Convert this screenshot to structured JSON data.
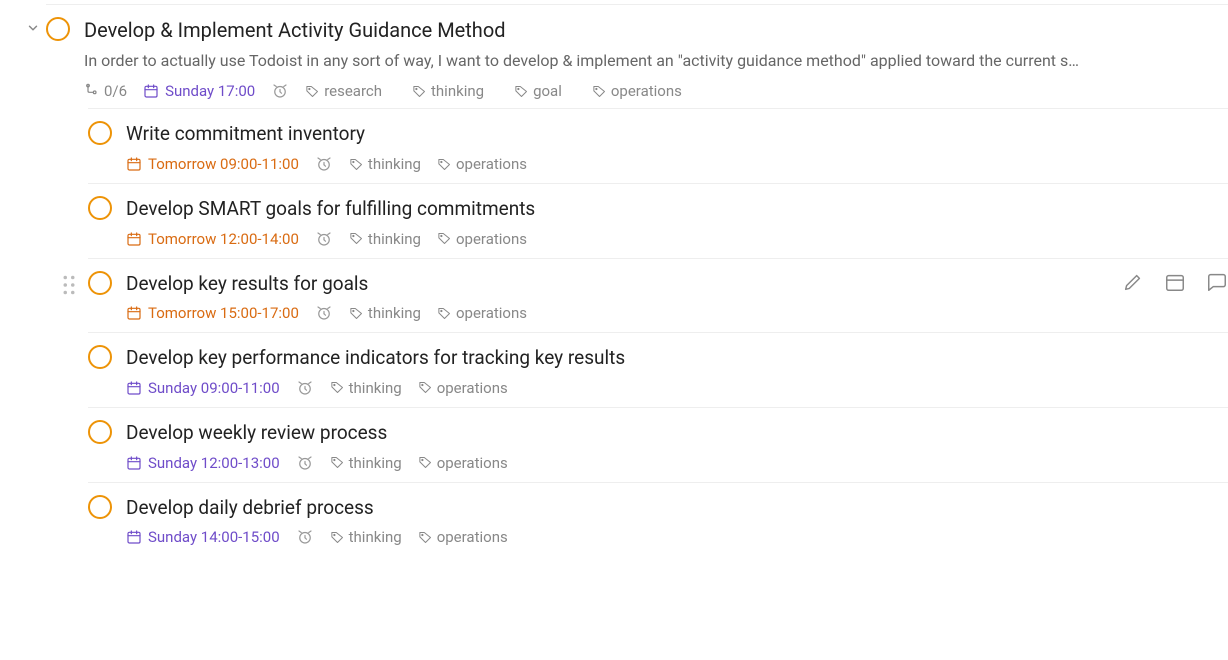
{
  "parent": {
    "title": "Develop & Implement Activity Guidance Method",
    "description": "In order to actually use Todoist in any sort of way, I want to develop & implement an \"activity guidance method\" applied toward the current s…",
    "subtask_count": "0/6",
    "due": "Sunday 17:00",
    "due_color": "purple",
    "tags": [
      "research",
      "thinking",
      "goal",
      "operations"
    ]
  },
  "subtasks": [
    {
      "title": "Write commitment inventory",
      "due": "Tomorrow 09:00-11:00",
      "due_color": "orange",
      "tags": [
        "thinking",
        "operations"
      ],
      "hovered": false
    },
    {
      "title": "Develop SMART goals for fulfilling commitments",
      "due": "Tomorrow 12:00-14:00",
      "due_color": "orange",
      "tags": [
        "thinking",
        "operations"
      ],
      "hovered": false
    },
    {
      "title": "Develop key results for goals",
      "due": "Tomorrow 15:00-17:00",
      "due_color": "orange",
      "tags": [
        "thinking",
        "operations"
      ],
      "hovered": true
    },
    {
      "title": "Develop key performance indicators for tracking key results",
      "due": "Sunday 09:00-11:00",
      "due_color": "purple",
      "tags": [
        "thinking",
        "operations"
      ],
      "hovered": false
    },
    {
      "title": "Develop weekly review process",
      "due": "Sunday 12:00-13:00",
      "due_color": "purple",
      "tags": [
        "thinking",
        "operations"
      ],
      "hovered": false
    },
    {
      "title": "Develop daily debrief process",
      "due": "Sunday 14:00-15:00",
      "due_color": "purple",
      "tags": [
        "thinking",
        "operations"
      ],
      "hovered": false
    }
  ]
}
